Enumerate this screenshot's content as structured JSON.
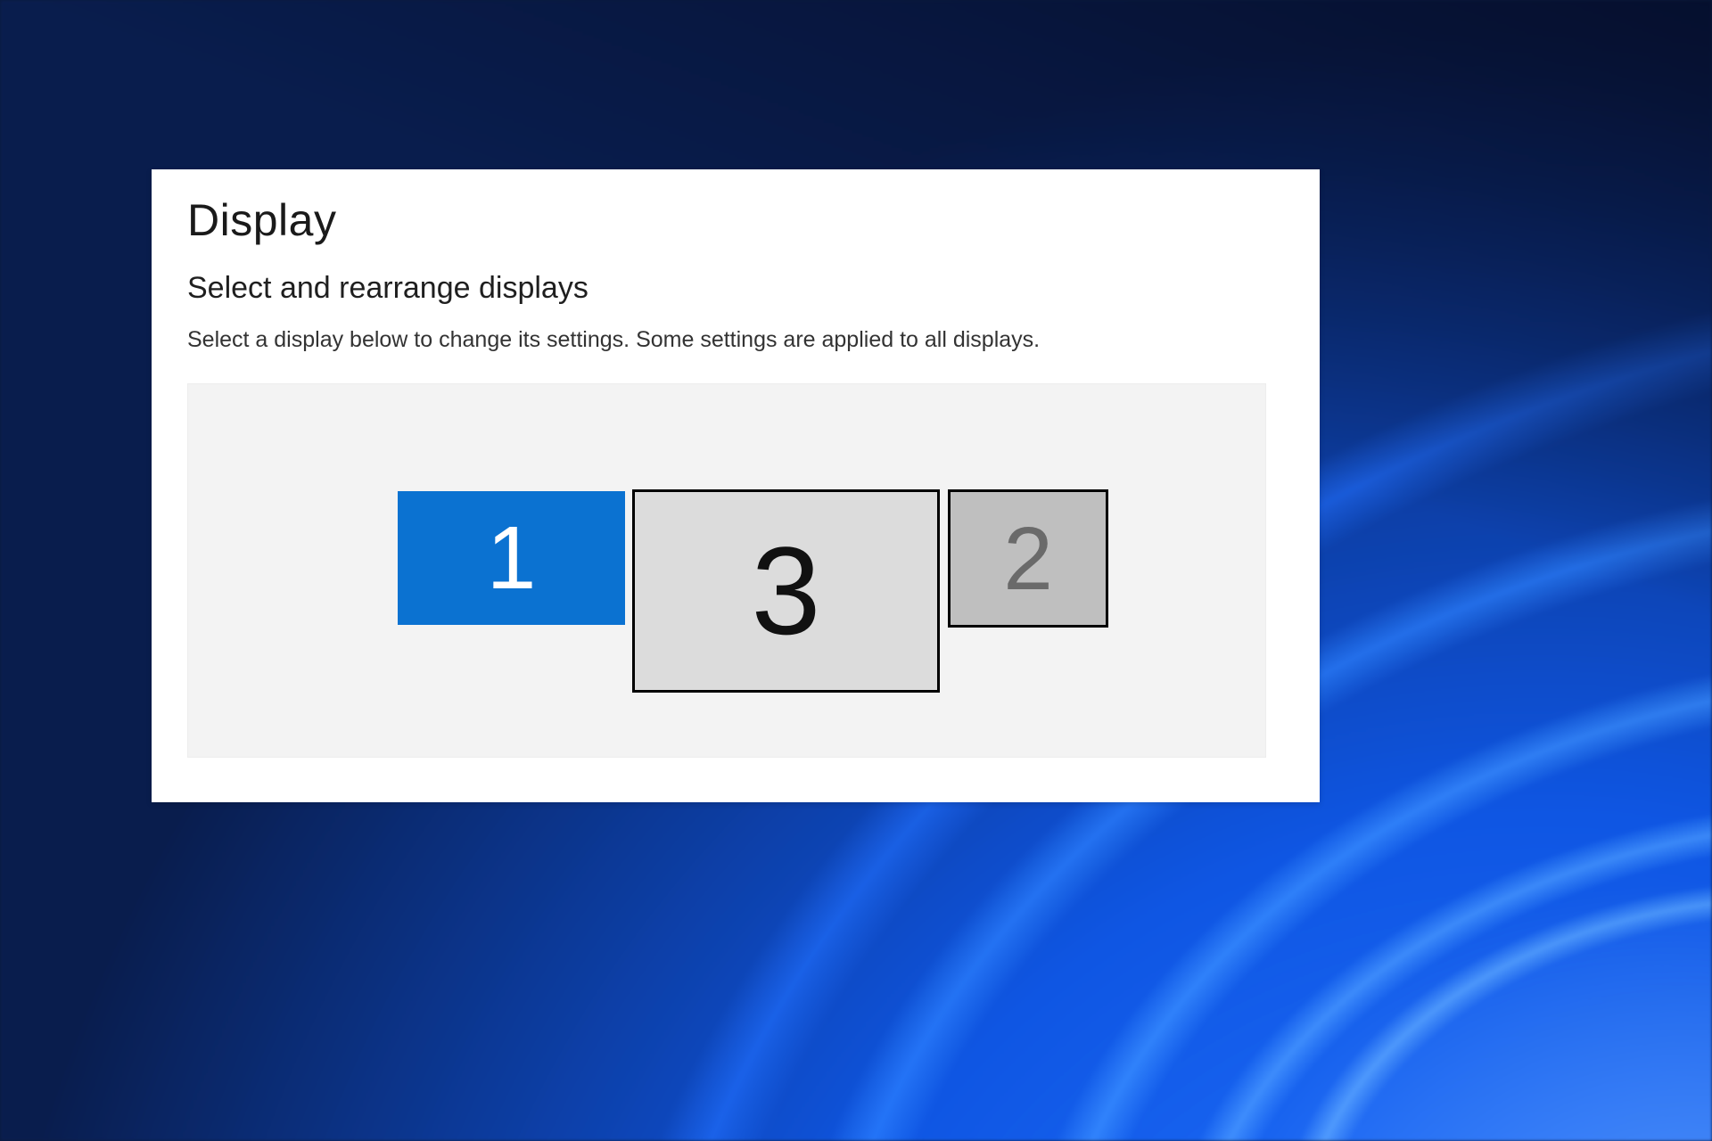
{
  "page": {
    "title": "Display",
    "section_title": "Select and rearrange displays",
    "helper": "Select a display below to change its settings. Some settings are applied to all displays."
  },
  "monitors": {
    "one": {
      "label": "1",
      "selected": true
    },
    "three": {
      "label": "3",
      "selected": false
    },
    "two": {
      "label": "2",
      "selected": false
    }
  },
  "colors": {
    "accent": "#0b72d1",
    "panel_bg": "#ffffff",
    "arrange_bg": "#f3f3f3"
  }
}
